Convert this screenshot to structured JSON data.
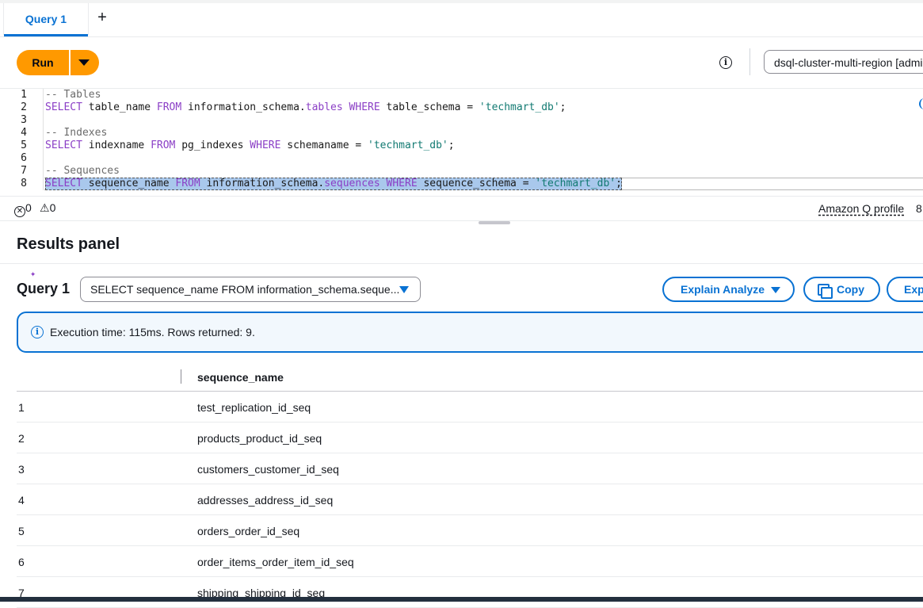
{
  "tabs": {
    "active_label": "Query 1",
    "add_label": "+"
  },
  "toolbar": {
    "run_label": "Run",
    "info_glyph": "i",
    "cluster_selected": "dsql-cluster-multi-region [admin]"
  },
  "editor": {
    "line_numbers": [
      "1",
      "2",
      "3",
      "4",
      "5",
      "6",
      "7",
      "8"
    ],
    "comment_tables": "-- Tables",
    "comment_indexes": "-- Indexes",
    "comment_sequences": "-- Sequences",
    "kw_select": "SELECT",
    "kw_from": "FROM",
    "kw_where": "WHERE",
    "l2_col": " table_name ",
    "l2_src": " information_schema.",
    "l2_tbl": "tables",
    "l2_cond": " table_schema = ",
    "l5_col": " indexname ",
    "l5_src": " pg_indexes ",
    "l5_cond": " schemaname = ",
    "l8_col": " sequence_name ",
    "l8_src": " information_schema.",
    "l8_tbl": "sequences",
    "l8_cond": " sequence_schema = ",
    "schema_str": "'techmart_db'",
    "semicolon": ";",
    "sparkle_glyph": "✦"
  },
  "status": {
    "errors": "0",
    "warnings": "0",
    "q_profile": "Amazon Q profile",
    "more": "8"
  },
  "results": {
    "title": "Results panel",
    "query_label": "Query 1",
    "query_select": "SELECT sequence_name FROM information_schema.seque...",
    "explain_label": "Explain Analyze",
    "copy_label": "Copy",
    "export_label": "Export",
    "info_glyph": "i",
    "execution_message": "Execution time: 115ms. Rows returned: 9.",
    "column_header": "sequence_name",
    "rows": [
      {
        "idx": "1",
        "value": "test_replication_id_seq"
      },
      {
        "idx": "2",
        "value": "products_product_id_seq"
      },
      {
        "idx": "3",
        "value": "customers_customer_id_seq"
      },
      {
        "idx": "4",
        "value": "addresses_address_id_seq"
      },
      {
        "idx": "5",
        "value": "orders_order_id_seq"
      },
      {
        "idx": "6",
        "value": "order_items_order_item_id_seq"
      },
      {
        "idx": "7",
        "value": "shipping_shipping_id_seq"
      }
    ]
  },
  "colors": {
    "accent": "#0972d3",
    "run": "#ff9900"
  }
}
